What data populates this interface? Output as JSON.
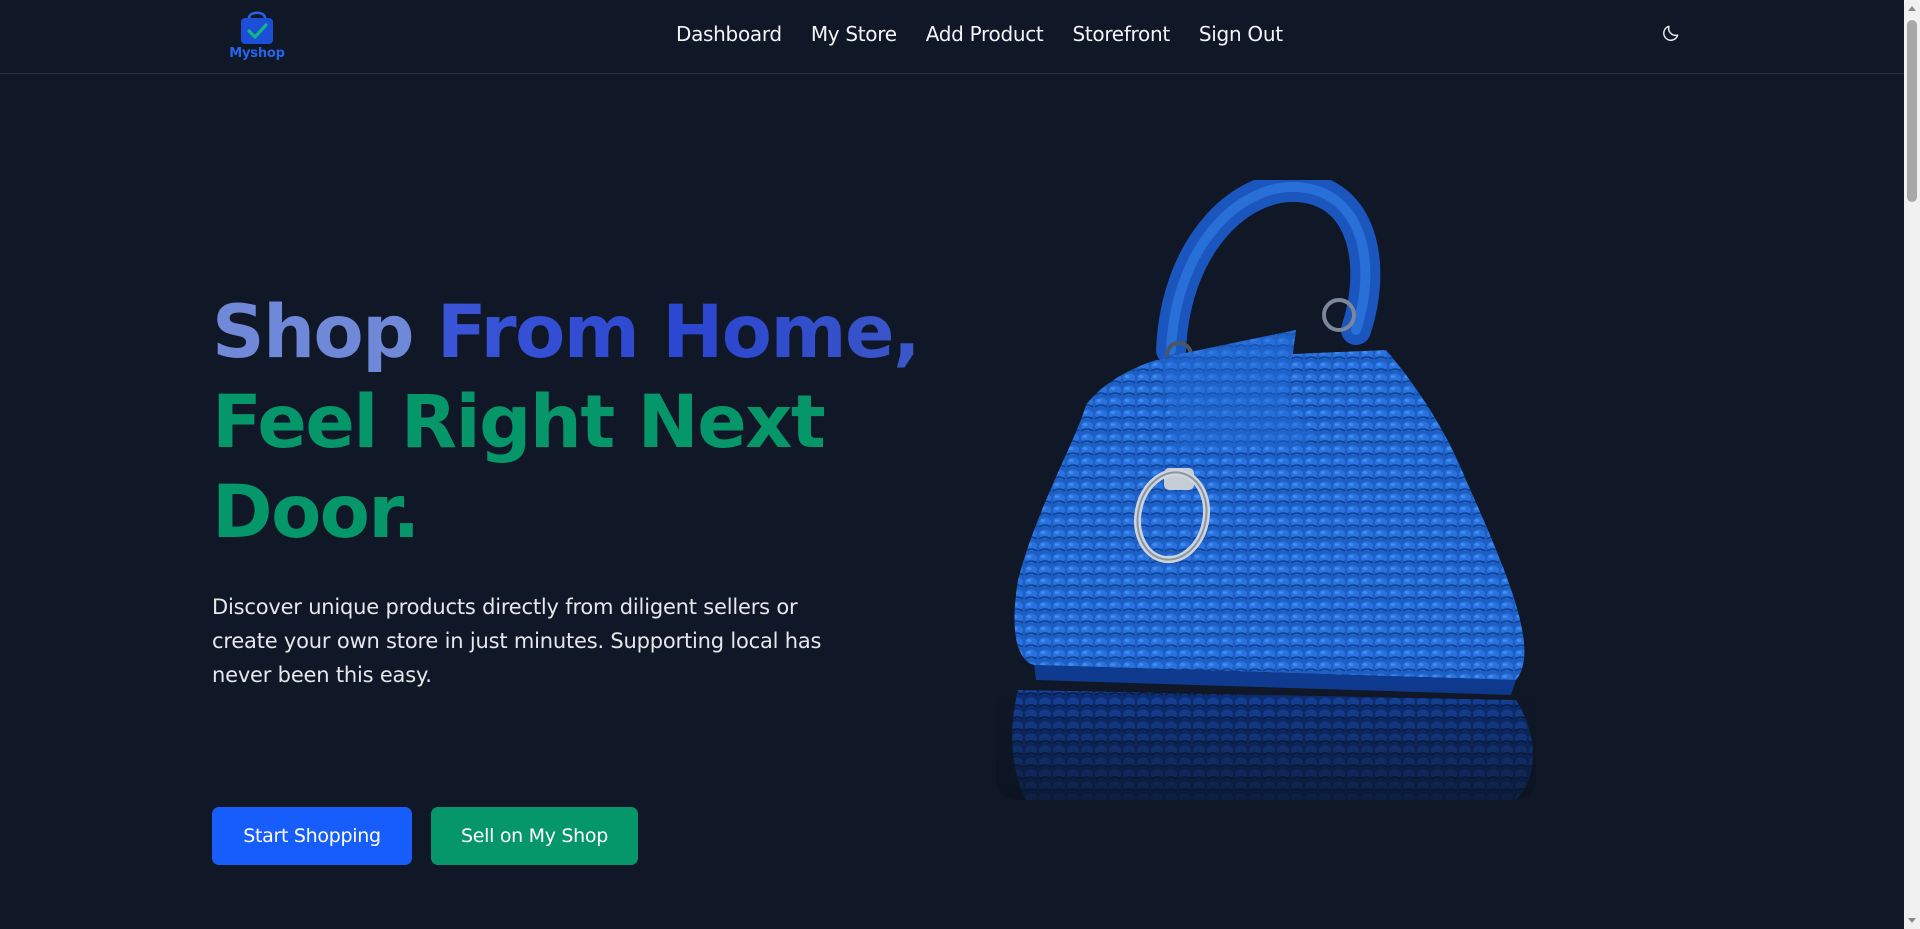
{
  "brand": {
    "name": "Myshop",
    "color": "#2563eb",
    "icon": "shopping-bag-check-icon"
  },
  "nav": {
    "items": [
      {
        "label": "Dashboard"
      },
      {
        "label": "My Store"
      },
      {
        "label": "Add Product"
      },
      {
        "label": "Storefront"
      },
      {
        "label": "Sign Out"
      }
    ],
    "theme_toggle_icon": "moon-icon"
  },
  "hero": {
    "headline": {
      "part1": "Shop ",
      "part2": "From Home,",
      "part3": "Feel Right Next Door."
    },
    "description": "Discover unique products directly from diligent sellers or create your own store in just minutes. Supporting local has never been this easy.",
    "primary_button": "Start Shopping",
    "secondary_button": "Sell on My Shop",
    "image": "blue-crochet-handbag"
  },
  "colors": {
    "background": "#101726",
    "primary": "#165dfb",
    "accent_green": "#059669",
    "headline_blue_light": "#6f88d8",
    "headline_blue": "#2b46cf"
  }
}
